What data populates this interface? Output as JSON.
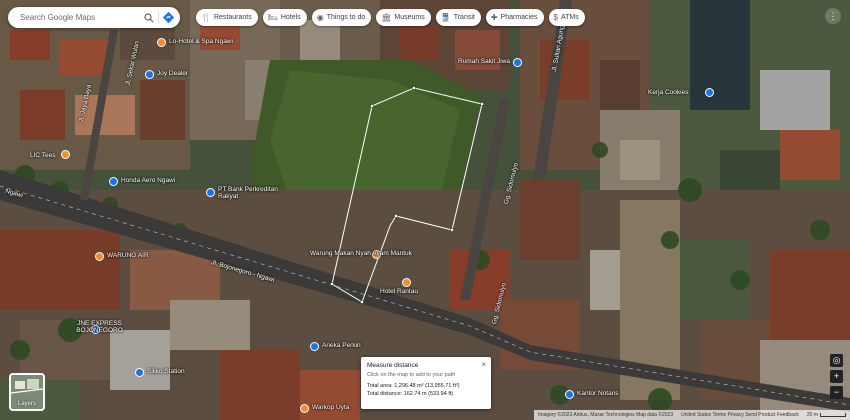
{
  "search": {
    "placeholder": "Search Google Maps"
  },
  "chips": [
    {
      "label": "Restaurants",
      "icon": "restaurant-icon",
      "glyph": "🍴"
    },
    {
      "label": "Hotels",
      "icon": "hotel-icon",
      "glyph": "🛏"
    },
    {
      "label": "Things to do",
      "icon": "camera-icon",
      "glyph": "◉"
    },
    {
      "label": "Museums",
      "icon": "museum-icon",
      "glyph": "🏛"
    },
    {
      "label": "Transit",
      "icon": "transit-icon",
      "glyph": "🚆"
    },
    {
      "label": "Pharmacies",
      "icon": "pharmacy-icon",
      "glyph": "✚"
    },
    {
      "label": "ATMs",
      "icon": "atm-icon",
      "glyph": "$"
    }
  ],
  "places": {
    "top_left": "Lo-Hotel & Spa Ngawi",
    "left_shop": "Joy Dealer",
    "left_tees": "LIC Tees",
    "honda": "Honda Aero Ngawi",
    "bank": "PT Bank Perkreditan Rakyat",
    "rumah": "Rumah Sakit Jiwa",
    "warung": "Warung Makan Nyah Ayam Mantuk",
    "hotel": "Hotel Rantau",
    "cookies": "Kerja Cookies",
    "kantor": "Kantor Notaris",
    "warung2": "WARUNG AIR",
    "jne": "JNE EXPRESS BOJONEGORO",
    "bottom1": "Siliko Station",
    "bottom2": "Aneka Perkin",
    "warkop": "Warkop Uyta"
  },
  "roads": {
    "main": "Jl. Bojonegoro - Ngawi",
    "main2": "Ngawi",
    "side1": "Gg. Sidomulyo",
    "side2": "Gg. Sidomulyo",
    "side3": "Jl. Sultan Agung",
    "left1": "Jl. Jaya Baya",
    "left2": "Jl. Sekar Wulan"
  },
  "measure": {
    "title": "Measure distance",
    "instruction": "Click on the map to add to your path",
    "area": "Total area: 1,296.48 m² (13,955.71 ft²)",
    "distance": "Total distance: 162.74 m (533.94 ft)",
    "close": "×"
  },
  "layers": {
    "label": "Layers"
  },
  "footer": {
    "attribution": "Imagery ©2023 Airbus, Maxar Technologies  Map data ©2023",
    "links": "United States   Terms   Privacy   Send Product Feedback",
    "scale": "20 m"
  },
  "controls": {
    "zoom_in": "+",
    "zoom_out": "−"
  },
  "colors": {
    "measure_line": "#ffffff",
    "pin_orange": "#f28b2b",
    "pin_blue": "#1a73e8"
  }
}
